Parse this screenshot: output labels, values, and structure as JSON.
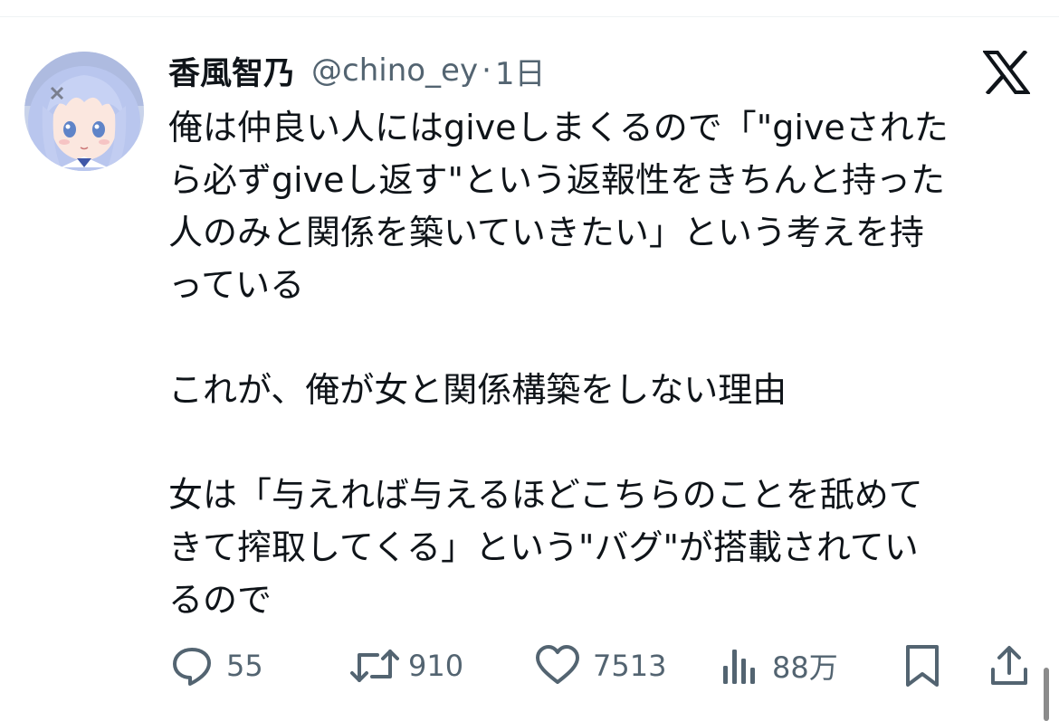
{
  "tweet": {
    "display_name": "香風智乃",
    "handle": "@chino_ey",
    "separator": "·",
    "time": "1日",
    "lines": [
      "俺は仲良い人にはgiveしまくるので「\"giveされた",
      "ら必ずgiveし返す\"という返報性をきちんと持った",
      "人のみと関係を築いていきたい」という考えを持",
      "っている",
      "これが、俺が女と関係構築をしない理由",
      "女は「与えれば与えるほどこちらのことを舐めて",
      "きて搾取してくる」という\"バグ\"が搭載されてい",
      "るので"
    ]
  },
  "actions": {
    "reply_count": "55",
    "retweet_count": "910",
    "like_count": "7513",
    "view_count": "88万"
  },
  "icons": {
    "platform": "x-logo-icon",
    "reply": "reply-icon",
    "retweet": "retweet-icon",
    "like": "heart-icon",
    "views": "views-icon",
    "bookmark": "bookmark-icon",
    "share": "share-icon"
  },
  "colors": {
    "text_primary": "#0f1419",
    "text_secondary": "#536471",
    "divider": "#eff3f4"
  }
}
